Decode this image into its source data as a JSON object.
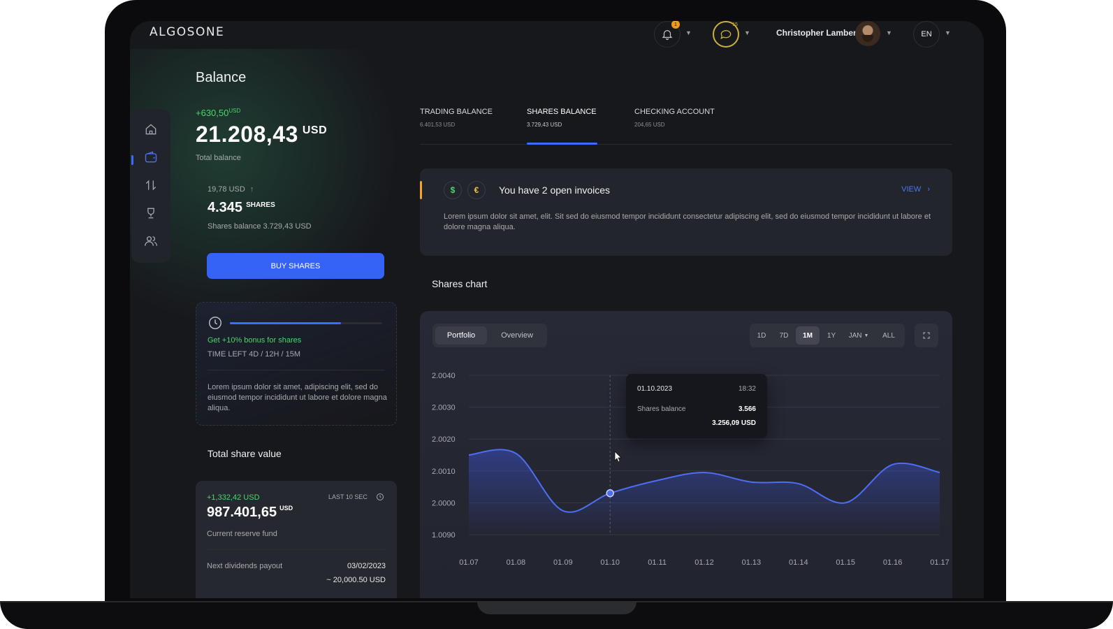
{
  "app": {
    "logo": "ALGOSONE"
  },
  "header": {
    "notifications_badge": "1",
    "chat_badge": "15",
    "user_name": "Christopher Lambert",
    "language": "EN"
  },
  "sidebar": {
    "items": [
      {
        "icon": "home-icon",
        "active": false
      },
      {
        "icon": "wallet-icon",
        "active": true
      },
      {
        "icon": "transfer-icon",
        "active": false
      },
      {
        "icon": "trophy-icon",
        "active": false
      },
      {
        "icon": "users-icon",
        "active": false
      }
    ]
  },
  "balance": {
    "title": "Balance",
    "change": "+630,50",
    "change_unit": "USD",
    "total": "21.208,43",
    "total_unit": "USD",
    "total_label": "Total balance",
    "shares_price": "19,78 USD",
    "shares_count": "4.345",
    "shares_unit": "SHARES",
    "shares_balance": "Shares balance 3.729,43 USD",
    "buy_label": "BUY SHARES"
  },
  "bonus": {
    "progress": 0.73,
    "title": "Get +10% bonus for shares",
    "time_left": "TIME LEFT 4D / 12H / 15M",
    "text": "Lorem ipsum dolor sit amet,  adipiscing elit, sed do eiusmod tempor incididunt ut labore et dolore magna aliqua."
  },
  "share_value": {
    "title": "Total share value",
    "change": "+1,332,42 USD",
    "refresh": "LAST 10 SEC",
    "amount": "987.401,65",
    "amount_unit": "USD",
    "amount_label": "Current reserve fund",
    "dividends_label": "Next dividends payout",
    "dividends_date": "03/02/2023",
    "dividends_amount": "~ 20,000.50 USD"
  },
  "tabs": [
    {
      "label": "TRADING BALANCE",
      "value": "6.401,53 USD"
    },
    {
      "label": "SHARES BALANCE",
      "value": "3.729,43 USD"
    },
    {
      "label": "CHECKING ACCOUNT",
      "value": "204,65 USD"
    }
  ],
  "invoice": {
    "title": "You have 2 open invoices",
    "view": "VIEW",
    "text": "Lorem ipsum dolor sit amet, elit. Sit sed do eiusmod tempor incididunt consectetur adipiscing elit, sed do eiusmod tempor incididunt ut labore et dolore magna aliqua."
  },
  "chart_section": {
    "title": "Shares chart",
    "toggle": [
      "Portfolio",
      "Overview"
    ],
    "ranges": [
      "1D",
      "7D",
      "1M",
      "1Y",
      "JAN",
      "ALL"
    ],
    "active_range": "1M",
    "tooltip": {
      "date": "01.10.2023",
      "time": "18:32",
      "label": "Shares balance",
      "shares": "3.566",
      "value": "3.256,09 USD"
    }
  },
  "chart_data": {
    "type": "area",
    "colors": {
      "line": "#4e6ef2",
      "fill": "#3a4fc4"
    },
    "y_ticks": [
      "2.0040",
      "2.0030",
      "2.0020",
      "2.0010",
      "2.0000",
      "1.0090"
    ],
    "x": [
      "01.07",
      "01.08",
      "01.09",
      "01.10",
      "01.11",
      "01.12",
      "01.13",
      "01.14",
      "01.15",
      "01.16",
      "01.17"
    ],
    "series": [
      {
        "values": [
          2.0015,
          2.00155,
          1.99975,
          2.0003,
          2.0007,
          2.00095,
          2.00065,
          2.0006,
          2.0,
          2.0012,
          2.00095
        ]
      }
    ],
    "highlight_index": 3,
    "grid": true
  }
}
